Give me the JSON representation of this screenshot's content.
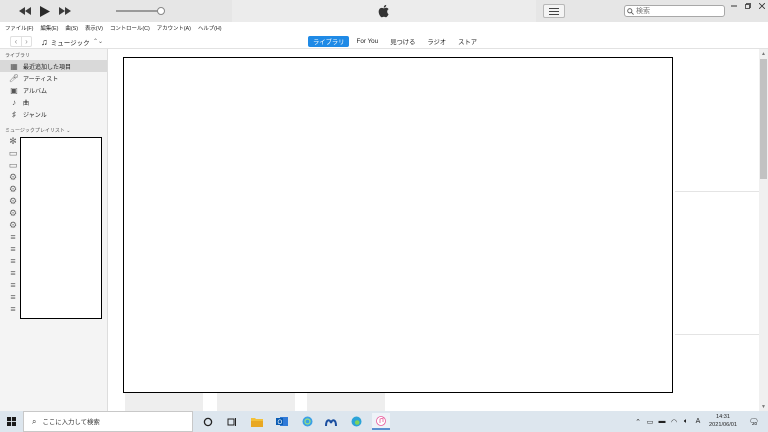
{
  "player": {
    "rewind_icon": "rewind-icon",
    "play_icon": "play-icon",
    "forward_icon": "fast-forward-icon",
    "volume_level": 0.9
  },
  "search": {
    "placeholder": "検索"
  },
  "menu": [
    "ファイル(F)",
    "編集(E)",
    "曲(S)",
    "表示(V)",
    "コントロール(C)",
    "アカウント(A)",
    "ヘルプ(H)"
  ],
  "nav": {
    "media_kind": "ミュージック",
    "tabs": [
      {
        "label": "ライブラリ",
        "active": true
      },
      {
        "label": "For You",
        "active": false
      },
      {
        "label": "見つける",
        "active": false
      },
      {
        "label": "ラジオ",
        "active": false
      },
      {
        "label": "ストア",
        "active": false
      }
    ]
  },
  "sidebar": {
    "library_heading": "ライブラリ",
    "items": [
      {
        "label": "最近追加した項目",
        "icon": "grid-icon",
        "selected": true
      },
      {
        "label": "アーティスト",
        "icon": "microphone-icon",
        "selected": false
      },
      {
        "label": "アルバム",
        "icon": "album-icon",
        "selected": false
      },
      {
        "label": "曲",
        "icon": "music-note-icon",
        "selected": false
      },
      {
        "label": "ジャンル",
        "icon": "genre-icon",
        "selected": false
      }
    ],
    "playlists_heading": "ミュージックプレイリスト",
    "playlist_icons": [
      "genius-icon",
      "folder-icon",
      "folder-icon",
      "gear-icon",
      "gear-icon",
      "gear-icon",
      "gear-icon",
      "gear-icon",
      "playlist-icon",
      "playlist-icon",
      "playlist-icon",
      "playlist-icon",
      "playlist-icon",
      "playlist-icon",
      "playlist-icon"
    ]
  },
  "taskbar": {
    "search_placeholder": "ここに入力して検索",
    "time": "14:31",
    "date": "2021/06/01",
    "notification_count": "20",
    "ime_label": "A"
  }
}
